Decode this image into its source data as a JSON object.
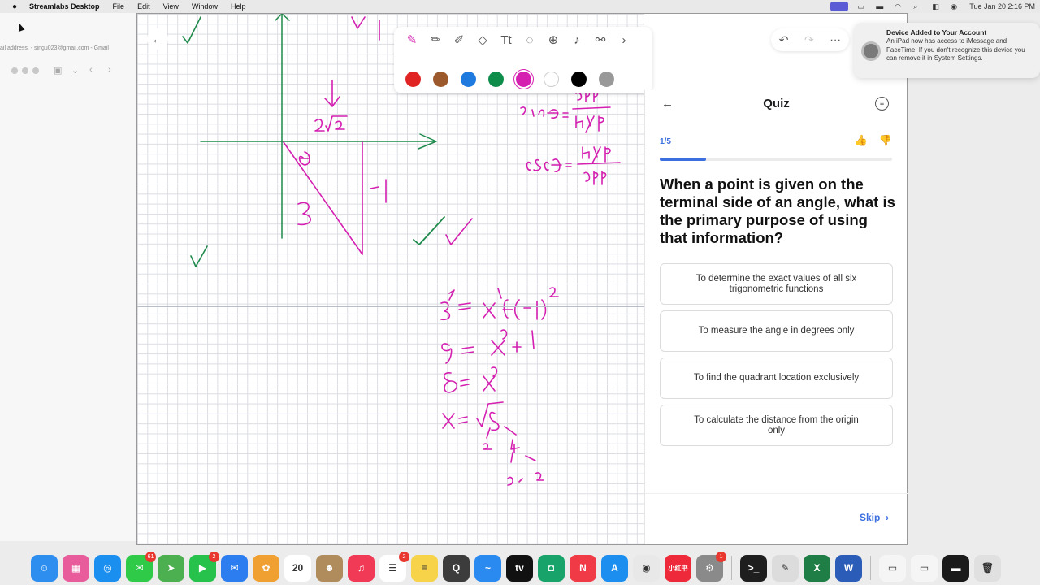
{
  "menubar": {
    "app_name": "Streamlabs Desktop",
    "menus": [
      "File",
      "Edit",
      "View",
      "Window",
      "Help"
    ],
    "clock": "Tue Jan 20  2:16 PM"
  },
  "background_window": {
    "tab_title": "ail address. - singu023@gmail.com - Gmail"
  },
  "toolbar": {
    "tools": [
      "pen-icon",
      "pencil-icon",
      "marker-icon",
      "eraser-icon",
      "text-icon",
      "lasso-icon",
      "add-icon",
      "microphone-icon",
      "link-icon",
      "chevron-right-icon"
    ],
    "colors": [
      "#e02424",
      "#9c5a2c",
      "#1f7ae0",
      "#0e8c4a",
      "#d41fb1",
      "#ffffff",
      "#000000",
      "#999999"
    ],
    "selected_color": "#d41fb1"
  },
  "quiz": {
    "title": "Quiz",
    "progress_text": "1/5",
    "progress_fraction": 0.2,
    "question": "When a point is given on the terminal side of an angle, what is the primary purpose of using that information?",
    "options": [
      "To determine the exact values of all six trigonometric functions",
      "To measure the angle in degrees only",
      "To find the quadrant location exclusively",
      "To calculate the distance from the origin only"
    ],
    "skip_label": "Skip"
  },
  "notification": {
    "title": "Device Added to Your Account",
    "body": "An iPad now has access to iMessage and FaceTime. If you don't recognize this device you can remove it in System Settings."
  },
  "dock": {
    "apps": [
      {
        "name": "finder",
        "color": "#2d8ef0",
        "glyph": "☺",
        "badge": ""
      },
      {
        "name": "launchpad",
        "color": "#e85c9c",
        "glyph": "▦",
        "badge": ""
      },
      {
        "name": "safari",
        "color": "#1b8ff0",
        "glyph": "◎",
        "badge": ""
      },
      {
        "name": "messages",
        "color": "#2fca48",
        "glyph": "✉",
        "badge": "61"
      },
      {
        "name": "maps",
        "color": "#4caf50",
        "glyph": "➤",
        "badge": ""
      },
      {
        "name": "facetime",
        "color": "#27c24c",
        "glyph": "▶",
        "badge": "2"
      },
      {
        "name": "mail",
        "color": "#2b7df0",
        "glyph": "✉",
        "badge": ""
      },
      {
        "name": "photos",
        "color": "#f0a030",
        "glyph": "✿",
        "badge": ""
      },
      {
        "name": "calendar",
        "color": "#ffffff",
        "glyph": "20",
        "badge": ""
      },
      {
        "name": "contacts",
        "color": "#b08b5c",
        "glyph": "☻",
        "badge": ""
      },
      {
        "name": "music",
        "color": "#f03a56",
        "glyph": "♫",
        "badge": ""
      },
      {
        "name": "reminders",
        "color": "#ffffff",
        "glyph": "☰",
        "badge": "2"
      },
      {
        "name": "notes",
        "color": "#f7d34a",
        "glyph": "≡",
        "badge": ""
      },
      {
        "name": "quicktime",
        "color": "#3c3c3c",
        "glyph": "Q",
        "badge": ""
      },
      {
        "name": "freeform",
        "color": "#2b8af0",
        "glyph": "~",
        "badge": ""
      },
      {
        "name": "apple-tv",
        "color": "#111111",
        "glyph": "tv",
        "badge": ""
      },
      {
        "name": "remote",
        "color": "#17a36a",
        "glyph": "◘",
        "badge": ""
      },
      {
        "name": "news",
        "color": "#f03a46",
        "glyph": "N",
        "badge": ""
      },
      {
        "name": "app-store",
        "color": "#1c8ef0",
        "glyph": "A",
        "badge": ""
      },
      {
        "name": "chrome",
        "color": "#e8e8e8",
        "glyph": "◉",
        "badge": ""
      },
      {
        "name": "rednote",
        "color": "#ee2a3a",
        "glyph": "小红书",
        "badge": ""
      },
      {
        "name": "system-settings",
        "color": "#8a8a8a",
        "glyph": "⚙",
        "badge": "1"
      },
      {
        "name": "terminal",
        "color": "#1e1e1e",
        "glyph": ">_",
        "badge": ""
      },
      {
        "name": "script-editor",
        "color": "#dcdcdc",
        "glyph": "✎",
        "badge": ""
      },
      {
        "name": "excel",
        "color": "#1e7e45",
        "glyph": "X",
        "badge": ""
      },
      {
        "name": "word",
        "color": "#2b5db8",
        "glyph": "W",
        "badge": ""
      },
      {
        "name": "document",
        "color": "#f5f5f5",
        "glyph": "▭",
        "badge": ""
      },
      {
        "name": "folder",
        "color": "#f5f5f5",
        "glyph": "▭",
        "badge": ""
      },
      {
        "name": "screen-recording",
        "color": "#1a1a1a",
        "glyph": "▬",
        "badge": ""
      },
      {
        "name": "trash",
        "color": "#e0e0e0",
        "glyph": "🗑",
        "badge": ""
      }
    ]
  }
}
